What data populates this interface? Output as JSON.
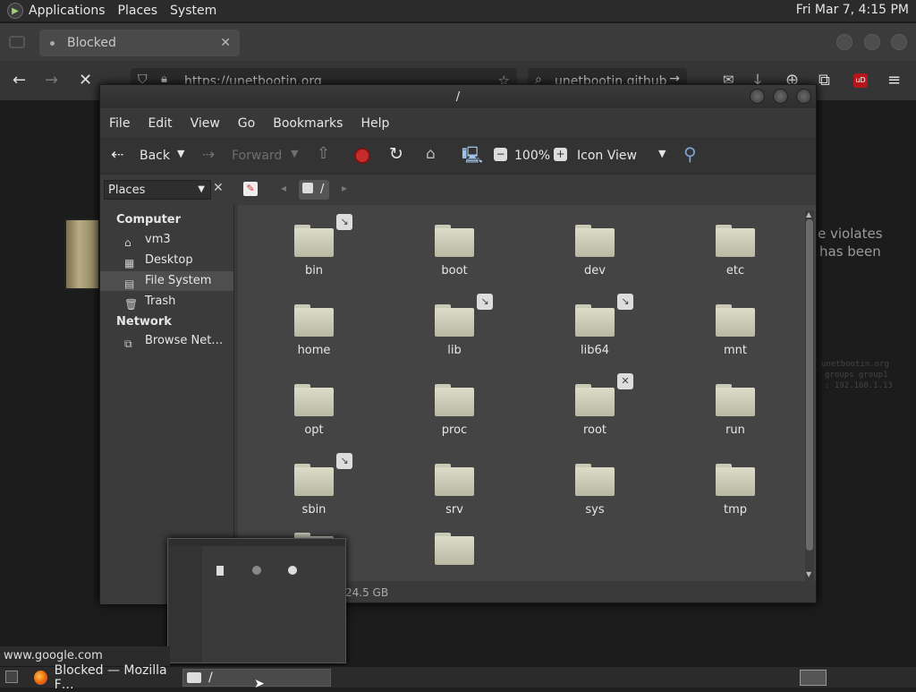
{
  "top_panel": {
    "menus": [
      "Applications",
      "Places",
      "System"
    ],
    "clock": "Fri Mar  7,  4:15 PM"
  },
  "firefox": {
    "tab_title": "Blocked",
    "url": "https://unetbootin.org",
    "search": "unetbootin.github",
    "content_text": [
      "e violates",
      "has been"
    ],
    "mono_text": [
      "unetbootin.org",
      "groups group1",
      ": 192.168.1.13"
    ],
    "status_url": "www.google.com"
  },
  "nautilus": {
    "title": "/",
    "menu": [
      "File",
      "Edit",
      "View",
      "Go",
      "Bookmarks",
      "Help"
    ],
    "toolbar": {
      "back": "Back",
      "forward": "Forward",
      "zoom": "100%",
      "view_mode": "Icon View"
    },
    "sidebar_select": "Places",
    "path": "/",
    "sidebar": {
      "computer_header": "Computer",
      "items": [
        "vm3",
        "Desktop",
        "File System",
        "Trash"
      ],
      "network_header": "Network",
      "network_items": [
        "Browse Net…"
      ]
    },
    "folders": [
      "bin",
      "boot",
      "dev",
      "etc",
      "home",
      "lib",
      "lib64",
      "mnt",
      "opt",
      "proc",
      "root",
      "run",
      "sbin",
      "srv",
      "sys",
      "tmp"
    ],
    "status": "24.5 GB"
  },
  "taskbar": {
    "firefox": "Blocked — Mozilla F…",
    "nautilus": "/"
  }
}
